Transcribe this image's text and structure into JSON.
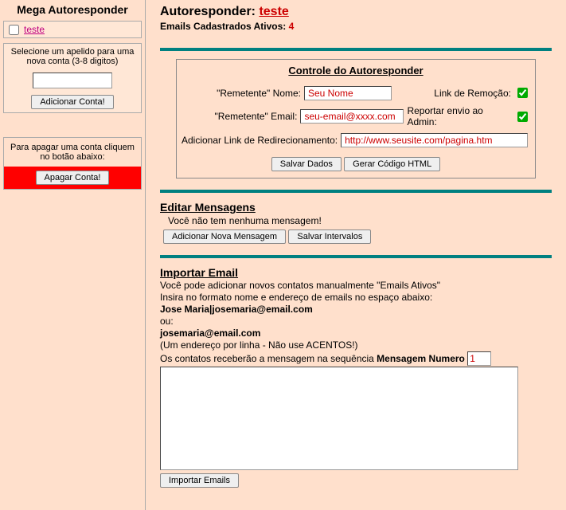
{
  "sidebar": {
    "title": "Mega Autoresponder",
    "accounts": [
      {
        "name": "teste"
      }
    ],
    "help_new": "Selecione um apelido para uma nova conta (3-8 digitos)",
    "new_account_value": "",
    "add_button": "Adicionar Conta!",
    "delete_help": "Para apagar uma conta cliquem no botão abaixo:",
    "delete_button": "Apagar Conta!"
  },
  "header": {
    "title": "Autoresponder:",
    "name": "teste",
    "sub_label": "Emails Cadastrados Ativos:",
    "sub_count": "4"
  },
  "control": {
    "title": "Controle do Autoresponder",
    "rem_name_label": "\"Remetente\" Nome:",
    "rem_name_value": "Seu Nome",
    "link_remocao_label": "Link de Remoção:",
    "link_remocao_checked": true,
    "rem_email_label": "\"Remetente\" Email:",
    "rem_email_value": "seu-email@xxxx.com",
    "report_admin_label": "Reportar envio ao Admin:",
    "report_admin_checked": true,
    "redirect_label": "Adicionar Link de Redirecionamento:",
    "redirect_value": "http://www.seusite.com/pagina.htm",
    "save_button": "Salvar Dados",
    "gen_button": "Gerar Código HTML"
  },
  "messages": {
    "title": "Editar Mensagens",
    "none": "Você não tem nenhuma mensagem!",
    "add_button": "Adicionar Nova Mensagem",
    "save_int_button": "Salvar Intervalos"
  },
  "import": {
    "title": "Importar Email",
    "line1": "Você pode adicionar novos contatos manualmente \"Emails Ativos\"",
    "line2": "Insira no formato nome e endereço de emails no espaço abaixo:",
    "example1": "Jose Maria|josemaria@email.com",
    "or": "ou:",
    "example2": "josemaria@email.com",
    "note": "(Um endereço por linha - Não use ACENTOS!)",
    "seq_text": "Os contatos receberão a mensagem na sequência",
    "seq_bold": "Mensagem Numero",
    "seq_num": "1",
    "area_value": "",
    "import_button": "Importar Emails"
  }
}
